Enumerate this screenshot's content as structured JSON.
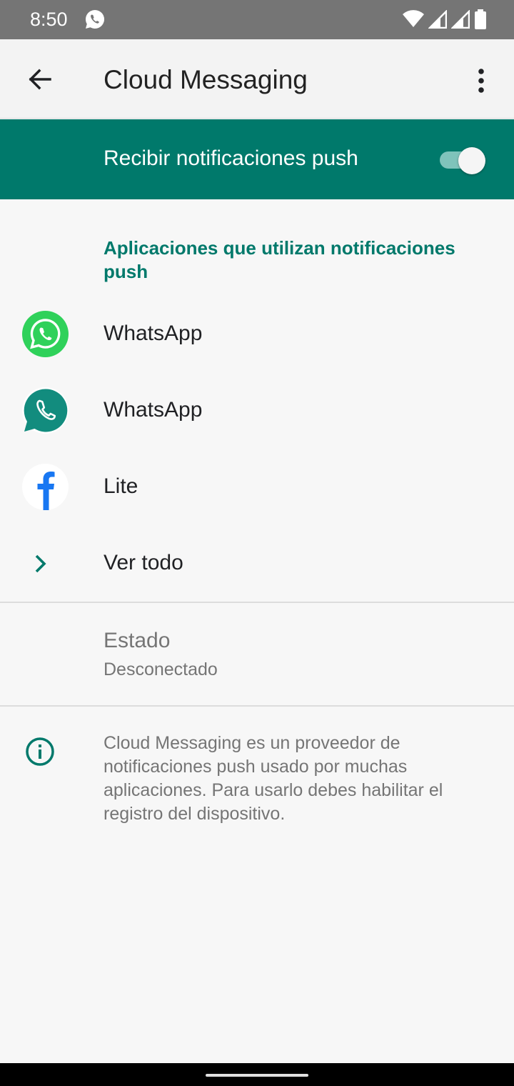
{
  "status_bar": {
    "time": "8:50",
    "notification_icon": "whatsapp-icon",
    "icons": [
      "wifi-icon",
      "signal-icon",
      "signal-icon",
      "battery-icon"
    ]
  },
  "app_bar": {
    "title": "Cloud Messaging",
    "back_icon": "arrow-back-icon",
    "menu_icon": "more-vert-icon"
  },
  "push": {
    "label": "Recibir notificaciones push",
    "enabled": true,
    "accent_color": "#00796b"
  },
  "apps_section": {
    "header": "Aplicaciones que utilizan notificaciones push",
    "apps": [
      {
        "label": "WhatsApp",
        "icon": "whatsapp-icon"
      },
      {
        "label": "WhatsApp",
        "icon": "whatsapp-business-icon"
      },
      {
        "label": "Lite",
        "icon": "facebook-lite-icon"
      }
    ],
    "see_all": "Ver todo"
  },
  "status": {
    "title": "Estado",
    "value": "Desconectado"
  },
  "info": {
    "icon": "info-icon",
    "text": "Cloud Messaging es un proveedor de notificaciones push usado por muchas aplicaciones. Para usarlo debes habilitar el registro del dispositivo."
  }
}
